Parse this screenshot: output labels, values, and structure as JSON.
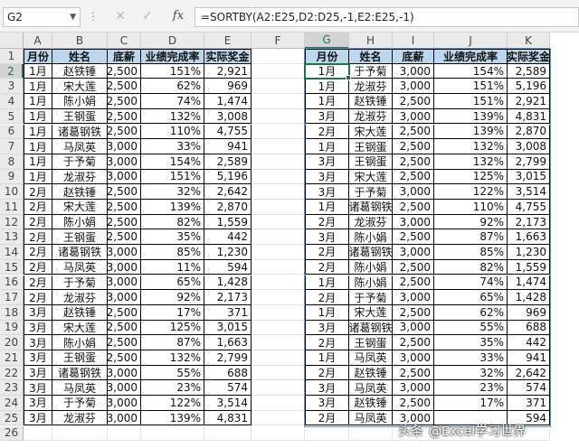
{
  "name_box": "G2",
  "formula_bar": {
    "cancel_icon": "✕",
    "enter_icon": "✓",
    "fx_label": "fx",
    "formula": "=SORTBY(A2:E25,D2:D25,-1,E2:E25,-1)"
  },
  "columns": [
    "A",
    "B",
    "C",
    "D",
    "E",
    "F",
    "G",
    "H",
    "I",
    "J",
    "K"
  ],
  "active_column": "G",
  "active_row": 2,
  "row_numbers": [
    "1",
    "2",
    "3",
    "4",
    "5",
    "6",
    "7",
    "8",
    "9",
    "10",
    "11",
    "12",
    "13",
    "14",
    "15",
    "16",
    "17",
    "18",
    "19",
    "20",
    "21",
    "22",
    "23",
    "24",
    "25",
    "26"
  ],
  "left_table": {
    "headers": [
      "月份",
      "姓名",
      "底薪",
      "业绩完成率",
      "实际奖金"
    ],
    "rows": [
      [
        "1月",
        "赵铁锤",
        "2,500",
        "151%",
        "2,921"
      ],
      [
        "1月",
        "宋大莲",
        "2,500",
        "62%",
        "969"
      ],
      [
        "1月",
        "陈小娟",
        "2,500",
        "74%",
        "1,474"
      ],
      [
        "1月",
        "王钢蛋",
        "2,500",
        "132%",
        "3,008"
      ],
      [
        "1月",
        "诸葛钢铁",
        "2,500",
        "110%",
        "4,755"
      ],
      [
        "1月",
        "马凤英",
        "3,000",
        "33%",
        "941"
      ],
      [
        "1月",
        "于予菊",
        "3,000",
        "154%",
        "2,589"
      ],
      [
        "1月",
        "龙淑芬",
        "3,000",
        "151%",
        "5,196"
      ],
      [
        "2月",
        "赵铁锤",
        "2,500",
        "32%",
        "2,642"
      ],
      [
        "2月",
        "宋大莲",
        "2,500",
        "139%",
        "2,870"
      ],
      [
        "2月",
        "陈小娟",
        "2,500",
        "82%",
        "1,559"
      ],
      [
        "2月",
        "王钢蛋",
        "2,500",
        "35%",
        "442"
      ],
      [
        "2月",
        "诸葛钢铁",
        "3,000",
        "85%",
        "1,230"
      ],
      [
        "2月",
        "马凤英",
        "3,000",
        "11%",
        "594"
      ],
      [
        "2月",
        "于予菊",
        "3,000",
        "65%",
        "1,428"
      ],
      [
        "2月",
        "龙淑芬",
        "3,000",
        "92%",
        "2,173"
      ],
      [
        "3月",
        "赵铁锤",
        "2,500",
        "17%",
        "371"
      ],
      [
        "3月",
        "宋大莲",
        "2,500",
        "125%",
        "3,015"
      ],
      [
        "3月",
        "陈小娟",
        "2,500",
        "87%",
        "1,663"
      ],
      [
        "3月",
        "王钢蛋",
        "2,500",
        "132%",
        "2,799"
      ],
      [
        "3月",
        "诸葛钢铁",
        "3,000",
        "55%",
        "688"
      ],
      [
        "3月",
        "马凤英",
        "3,000",
        "23%",
        "574"
      ],
      [
        "3月",
        "于予菊",
        "3,000",
        "122%",
        "3,514"
      ],
      [
        "3月",
        "龙淑芬",
        "3,000",
        "139%",
        "4,831"
      ]
    ]
  },
  "right_table": {
    "headers": [
      "月份",
      "姓名",
      "底薪",
      "业绩完成率",
      "实际奖金"
    ],
    "rows": [
      [
        "1月",
        "于予菊",
        "3,000",
        "154%",
        "2,589"
      ],
      [
        "1月",
        "龙淑芬",
        "3,000",
        "151%",
        "5,196"
      ],
      [
        "1月",
        "赵铁锤",
        "2,500",
        "151%",
        "2,921"
      ],
      [
        "3月",
        "龙淑芬",
        "3,000",
        "139%",
        "4,831"
      ],
      [
        "2月",
        "宋大莲",
        "2,500",
        "139%",
        "2,870"
      ],
      [
        "1月",
        "王钢蛋",
        "2,500",
        "132%",
        "3,008"
      ],
      [
        "3月",
        "王钢蛋",
        "2,500",
        "132%",
        "2,799"
      ],
      [
        "3月",
        "宋大莲",
        "2,500",
        "125%",
        "3,015"
      ],
      [
        "3月",
        "于予菊",
        "3,000",
        "122%",
        "3,514"
      ],
      [
        "1月",
        "诸葛钢铁",
        "2,500",
        "110%",
        "4,755"
      ],
      [
        "2月",
        "龙淑芬",
        "3,000",
        "92%",
        "2,173"
      ],
      [
        "3月",
        "陈小娟",
        "2,500",
        "87%",
        "1,663"
      ],
      [
        "2月",
        "诸葛钢铁",
        "3,000",
        "85%",
        "1,230"
      ],
      [
        "2月",
        "陈小娟",
        "2,500",
        "82%",
        "1,559"
      ],
      [
        "1月",
        "陈小娟",
        "2,500",
        "74%",
        "1,474"
      ],
      [
        "2月",
        "于予菊",
        "3,000",
        "65%",
        "1,428"
      ],
      [
        "1月",
        "宋大莲",
        "2,500",
        "62%",
        "969"
      ],
      [
        "3月",
        "诸葛钢铁",
        "3,000",
        "55%",
        "688"
      ],
      [
        "2月",
        "王钢蛋",
        "2,500",
        "35%",
        "442"
      ],
      [
        "1月",
        "马凤英",
        "3,000",
        "33%",
        "941"
      ],
      [
        "2月",
        "赵铁锤",
        "2,500",
        "32%",
        "2,642"
      ],
      [
        "3月",
        "马凤英",
        "3,000",
        "23%",
        "574"
      ],
      [
        "3月",
        "赵铁锤",
        "2,500",
        "17%",
        "371"
      ],
      [
        "2月",
        "马凤英",
        "3,000",
        "",
        "594"
      ]
    ]
  },
  "watermark": {
    "label": "头条",
    "text": "@Excel学习世界"
  },
  "colors": {
    "header_fill": "#bdd7ee",
    "excel_green": "#217346",
    "spill_border": "#5b9bd5"
  }
}
